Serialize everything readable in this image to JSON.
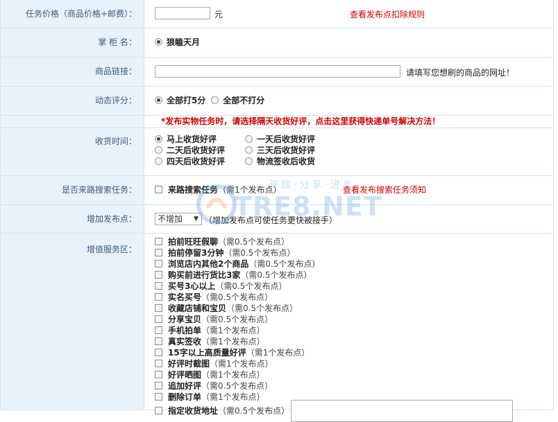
{
  "task_price": {
    "label": "任务价格（商品价格+邮费）：",
    "value": "",
    "unit": "元",
    "link": "查看发布点扣除规则"
  },
  "shopkeeper": {
    "label": "掌 柜 名：",
    "value": "狼瞌天月"
  },
  "product_link": {
    "label": "商品链接：",
    "value": "",
    "hint": "请填写您想刷的商品的网址！"
  },
  "rating": {
    "label": "动态评分：",
    "opt1": "全部打5分",
    "opt2": "全部不打分"
  },
  "notice": "*发布实物任务时，请选择隔天收货好评，点击这里获得快递单号解决方法！",
  "receipt": {
    "label": "收货时间：",
    "options": [
      "马上收货好评",
      "一天后收货好评",
      "二天后收货好评",
      "三天后收货好评",
      "四天后收货好评",
      "物流签收后收货"
    ]
  },
  "search_task": {
    "label": "是否来路搜索任务：",
    "opt": "来路搜索任务",
    "cost": "（需1个发布点）",
    "link": "查看发布搜索任务须知"
  },
  "add_points": {
    "label": "增加发布点：",
    "selected": "不增加",
    "hint": "（增加发布点可使任务更快被接手）"
  },
  "services": {
    "label": "增值服务区：",
    "items": [
      {
        "name": "拍前旺旺假聊",
        "cost": "（需0.5个发布点）"
      },
      {
        "name": "拍前停留3分钟",
        "cost": "（需0.5个发布点）"
      },
      {
        "name": "浏览店内其他2个商品",
        "cost": "（需0.5个发布点）"
      },
      {
        "name": "购买前进行货比3家",
        "cost": "（需0.5个发布点）"
      },
      {
        "name": "买号3心以上",
        "cost": "（需0.5个发布点）"
      },
      {
        "name": "实名买号",
        "cost": "（需0.5个发布点）"
      },
      {
        "name": "收藏店铺和宝贝",
        "cost": "（需0.5个发布点）"
      },
      {
        "name": "分享宝贝",
        "cost": "（需0.5个发布点）"
      },
      {
        "name": "手机拍单",
        "cost": "（需1个发布点）"
      },
      {
        "name": "真实签收",
        "cost": "（需1个发布点）"
      },
      {
        "name": "15字以上高质量好评",
        "cost": "（需1个发布点）"
      },
      {
        "name": "好评时截图",
        "cost": "（需1个发布点）"
      },
      {
        "name": "好评晒图",
        "cost": "（需1个发布点）"
      },
      {
        "name": "追加好评",
        "cost": "（需0.5个发布点）"
      },
      {
        "name": "删除订单",
        "cost": "（需1个发布点）"
      },
      {
        "name": "指定收货地址",
        "cost": "（需0.5个发布点）"
      }
    ]
  },
  "watermark": {
    "text": "TRE8.NET",
    "tagline": "开放·分享·进步"
  }
}
